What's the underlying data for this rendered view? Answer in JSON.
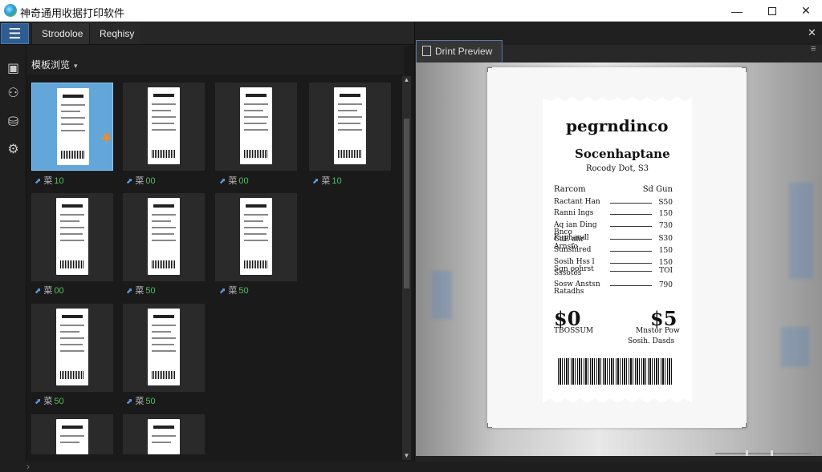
{
  "window": {
    "title": "神奇通用收据打印软件",
    "minimize": "—",
    "close": "✕"
  },
  "toolbar": {
    "menu_icon": "☰",
    "tabs": [
      "Strodoloe",
      "Reqhisy"
    ]
  },
  "sidebar_icons": [
    "document-icon",
    "people-icon",
    "database-icon",
    "settings-gear-icon"
  ],
  "gallery": {
    "dropdown_label": "模板浏览",
    "caret": "▾",
    "thumb_caption_prefix": "菜",
    "thumbs": [
      {
        "count": "10",
        "selected": true
      },
      {
        "count": "00",
        "selected": false
      },
      {
        "count": "00",
        "selected": false
      },
      {
        "count": "10",
        "selected": false
      },
      {
        "count": "00",
        "selected": false
      },
      {
        "count": "50",
        "selected": false
      },
      {
        "count": "50",
        "selected": false
      },
      {
        "count": "50",
        "selected": false
      },
      {
        "count": "50",
        "selected": false
      },
      {
        "count": "",
        "selected": false
      },
      {
        "count": "",
        "selected": false
      }
    ]
  },
  "preview": {
    "tab_label": "Drint Preview",
    "close": "✕",
    "menu": "≡",
    "receipt": {
      "title": "pegrndinco",
      "subtitle": "Socenhaptane",
      "meta_line": "Rocody Dot, S3",
      "columns": {
        "left": "Rarcom",
        "right": "Sd Gun"
      },
      "items": [
        {
          "label": "Ractant Han",
          "price": "S50"
        },
        {
          "label": "Ranni Ings",
          "price": "150"
        },
        {
          "label": "Aq ian Ding Bnco\nCdE ahr Arnsfo",
          "price": "730"
        },
        {
          "label": "Kuphandl",
          "price": "S30"
        },
        {
          "label": "Sunshired",
          "price": "150"
        },
        {
          "label": "Sosih Hss l\nSgn oohrst",
          "price": "150"
        },
        {
          "label": "Sssotes",
          "price": "TOI"
        },
        {
          "label": "Sosw Anstsn\nRatadhs",
          "price": "790"
        }
      ],
      "total_left": "$0",
      "total_left_sub": "TBOSSUM",
      "total_right": "$5",
      "total_right_sub1": "Mnstor Pow",
      "total_right_sub2": "Sosih. Dasds"
    }
  }
}
